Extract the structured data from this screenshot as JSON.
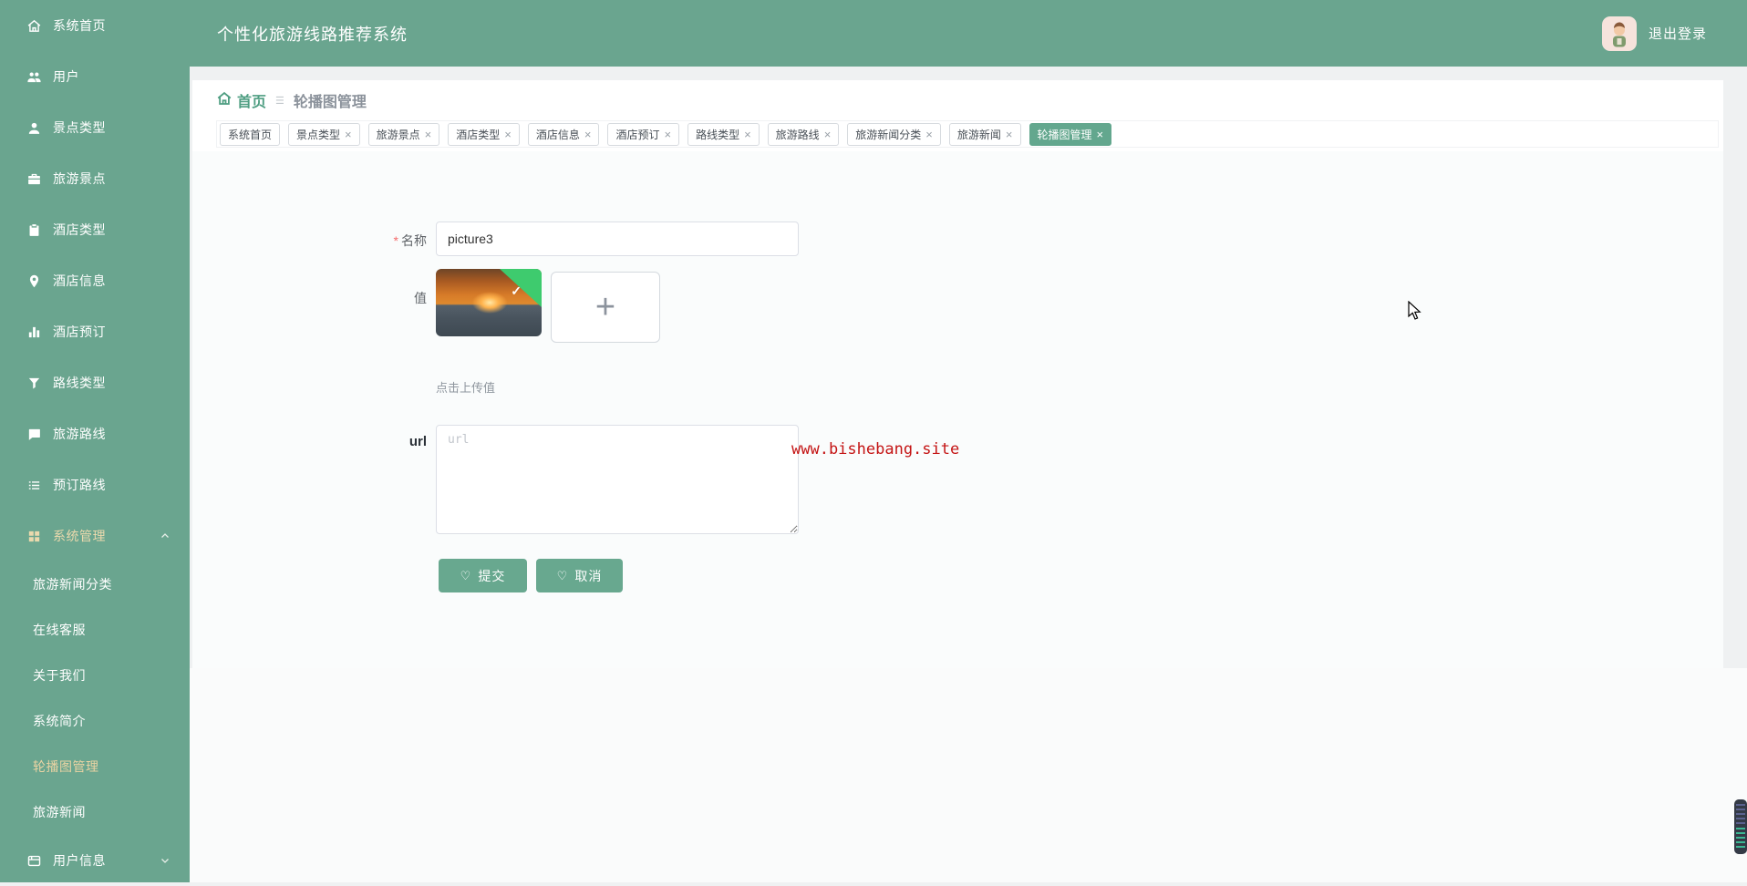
{
  "app": {
    "title": "个性化旅游线路推荐系统",
    "logout_label": "退出登录"
  },
  "colors": {
    "brand_green": "#6aa58f",
    "active_tab_green": "#63a78e",
    "active_menu_gold": "#e9d3a3",
    "breadcrumb_green": "#4f9e82",
    "watermark_red": "#c41414",
    "required_red": "#f56c6c"
  },
  "icons": {
    "close": "×",
    "plus": "+",
    "heart": "♡",
    "check": "✓",
    "required_asterisk": "*",
    "breadcrumb_separator": "☰"
  },
  "sidebar": {
    "items": [
      {
        "label": "系统首页",
        "icon": "home-icon"
      },
      {
        "label": "用户",
        "icon": "users-icon"
      },
      {
        "label": "景点类型",
        "icon": "person-icon"
      },
      {
        "label": "旅游景点",
        "icon": "briefcase-icon"
      },
      {
        "label": "酒店类型",
        "icon": "clipboard-icon"
      },
      {
        "label": "酒店信息",
        "icon": "location-pin-icon"
      },
      {
        "label": "酒店预订",
        "icon": "bar-chart-icon"
      },
      {
        "label": "路线类型",
        "icon": "filter-icon"
      },
      {
        "label": "旅游路线",
        "icon": "message-icon"
      },
      {
        "label": "预订路线",
        "icon": "list-icon"
      },
      {
        "label": "系统管理",
        "icon": "grid-icon",
        "expanded": true
      }
    ],
    "system_submenu": [
      "旅游新闻分类",
      "在线客服",
      "关于我们",
      "系统简介",
      "轮播图管理",
      "旅游新闻"
    ],
    "active_submenu": "轮播图管理",
    "user_info_item": {
      "label": "用户信息",
      "icon": "folder-icon",
      "expanded": false
    }
  },
  "breadcrumb": {
    "home": "首页",
    "current": "轮播图管理"
  },
  "tabs": [
    {
      "label": "系统首页",
      "closable": false,
      "active": false
    },
    {
      "label": "景点类型",
      "closable": true,
      "active": false
    },
    {
      "label": "旅游景点",
      "closable": true,
      "active": false
    },
    {
      "label": "酒店类型",
      "closable": true,
      "active": false
    },
    {
      "label": "酒店信息",
      "closable": true,
      "active": false
    },
    {
      "label": "酒店预订",
      "closable": true,
      "active": false
    },
    {
      "label": "路线类型",
      "closable": true,
      "active": false
    },
    {
      "label": "旅游路线",
      "closable": true,
      "active": false
    },
    {
      "label": "旅游新闻分类",
      "closable": true,
      "active": false
    },
    {
      "label": "旅游新闻",
      "closable": true,
      "active": false
    },
    {
      "label": "轮播图管理",
      "closable": true,
      "active": true
    }
  ],
  "form": {
    "name_label": "名称",
    "name_value": "picture3",
    "value_label": "值",
    "upload_hint": "点击上传值",
    "url_label": "url",
    "url_placeholder": "url",
    "url_value": "",
    "submit_label": "提交",
    "cancel_label": "取消"
  },
  "watermark": "www.bishebang.site"
}
